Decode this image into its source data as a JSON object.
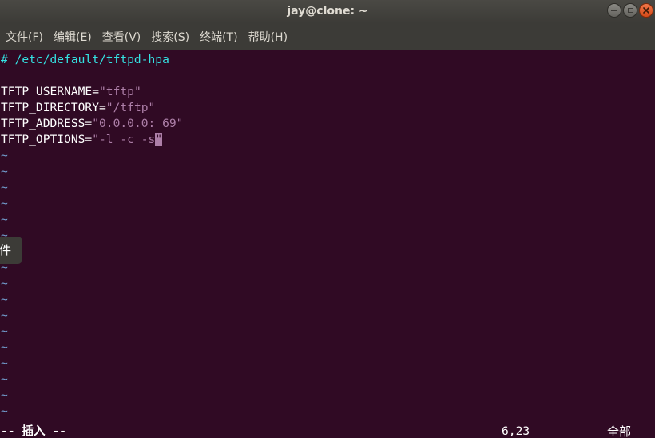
{
  "window": {
    "title": "jay@clone: ~"
  },
  "menu": {
    "items": [
      "文件(F)",
      "编辑(E)",
      "查看(V)",
      "搜索(S)",
      "终端(T)",
      "帮助(H)"
    ]
  },
  "editor": {
    "comment": "# /etc/default/tftpd-hpa",
    "lines": [
      {
        "key": "TFTP_USERNAME=",
        "value": "\"tftp\""
      },
      {
        "key": "TFTP_DIRECTORY=",
        "value": "\"/tftp\""
      },
      {
        "key": "TFTP_ADDRESS=",
        "value": "\"0.0.0.0: 69\""
      },
      {
        "key": "TFTP_OPTIONS=",
        "value": "\"-l -c -s",
        "cursor_char": "\""
      }
    ],
    "tilde": "~"
  },
  "status": {
    "mode": "-- 插入 --",
    "position": "6,23",
    "scope": "全部"
  },
  "tooltip": {
    "text": "件"
  },
  "colors": {
    "background": "#300a24",
    "comment": "#34e2e2",
    "string": "#ad7fa8",
    "tilde": "#729fcf"
  }
}
